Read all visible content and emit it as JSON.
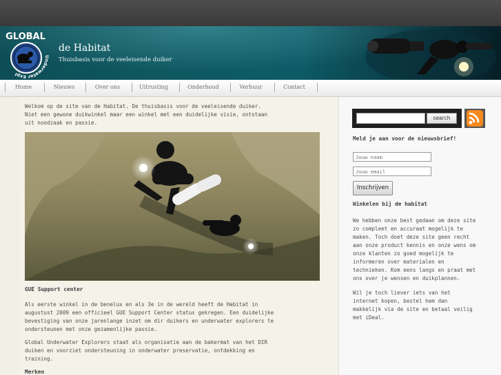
{
  "header": {
    "logo_text_top": "GLOBAL",
    "logo_text_ring": "Underwater Explorers",
    "title": "de Habitat",
    "subtitle": "Thuisbasis voor de veeleisende duiker"
  },
  "nav": {
    "items": [
      "Home",
      "Nieuws",
      "Over ons",
      "Uitrusting",
      "Onderhoud",
      "Verhuur",
      "Contact"
    ]
  },
  "main": {
    "intro": [
      "Welkom op de site van de Habitat. De thuisbasis voor de veeleisende duiker.",
      "Niet een gewone duikwinkel maar een winkel met een duidelijke visie, ontstaan",
      "uit noodzaak en passie."
    ],
    "gue_heading": "GUE Support center",
    "gue_text": [
      "Als eerste winkel in de benelux en als 3e in de wereld heeft de Habitat in",
      "augustust 2009 een officieel GUE Support Center status gekregen. Een duidelijke",
      "bevestiging van onze jarenlange inzet om dir duikers en underwater explorers te",
      "ondersteunen met onze gezamenlijke passie."
    ],
    "gue_text2": [
      "Global Underwater Explorers staat als organisatie aan de bakermat van het DIR",
      "duiken en voorziet ondersteuning in onderwater preservatie, ontdekking en",
      "training."
    ],
    "merken_heading": "Merken"
  },
  "sidebar": {
    "search_value": "",
    "search_button": "search",
    "newsletter_heading": "Meld je aan voor de nieuwsbrief!",
    "name_placeholder": "Jouw naam",
    "email_placeholder": "Jouw email",
    "subscribe_button": "Inschrijven",
    "shop_heading": "Winkelen bij de habitat",
    "shop_text": [
      "We hebben onze best gedaan om deze site",
      "zo compleet en accuraat mogelijk te",
      "maken. Toch doet deze site geen recht",
      "aan onze product kennis en onze wens om",
      "onze klanten zo goed mogelijk te",
      "informeren over materialen en",
      "technieken. Kom eens langs en praat met",
      "ons over je wensen en duikplannen."
    ],
    "shop_text2": [
      "Wil je toch liever iets van het",
      "internet kopen, bestel hem dan",
      "makkelijk via de site en betaal veilig",
      "met iDeal."
    ]
  },
  "colors": {
    "banner": "#0f5963",
    "background": "#f2efe6",
    "topbar": "#444444",
    "rss": "#f4891f"
  }
}
